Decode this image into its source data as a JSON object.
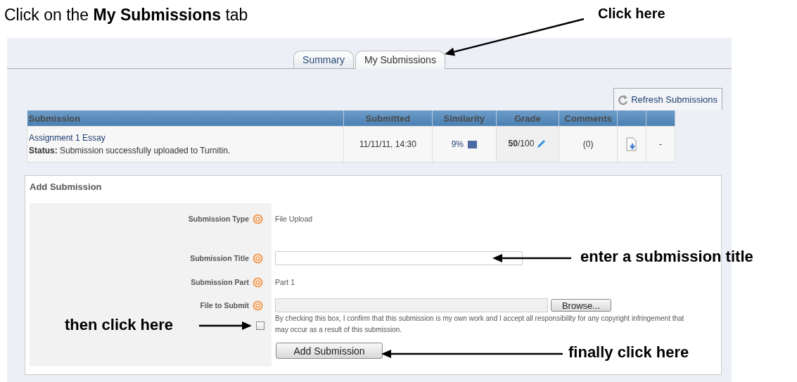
{
  "instruction": "Click on the **My Submissions** tab",
  "callouts": [
    {
      "kind": "tab",
      "text": "Click here"
    },
    {
      "kind": "title",
      "text": "enter a submission title"
    },
    {
      "kind": "checkbox",
      "text": "then click here"
    },
    {
      "kind": "button",
      "text": "finally click here"
    }
  ],
  "tabs": [
    {
      "label": "Summary",
      "selected": false
    },
    {
      "label": "My Submissions",
      "selected": true
    }
  ],
  "refresh_button": "Refresh Submissions",
  "table": {
    "columns": [
      "Submission",
      "Submitted",
      "Similarity",
      "Grade",
      "Comments"
    ],
    "rows": [
      {
        "title": "Assignment 1 Essay",
        "status": "**Status:** Submission successfully uploaded to Turnitin.",
        "submitted": "11/11/11, 14:30",
        "similarity": "9%",
        "grade": "**50**/100",
        "comments": "(0)",
        "column_7": "-"
      }
    ]
  },
  "add_submission": {
    "title": "Add Submission",
    "fields": [
      {
        "kind": "text",
        "label": "Submission Type",
        "value": "File Upload"
      },
      {
        "kind": "input",
        "label": "Submission Title"
      },
      {
        "kind": "text",
        "label": "Submission Part",
        "value": "Part 1"
      },
      {
        "kind": "file",
        "label": "File to Submit",
        "button": "Browse..."
      }
    ],
    "agreement": {
      "checked": false,
      "text": "By checking this box, I confirm that this submission is my own work and I accept all responsibility for any copyright infringement that may occur as a result of this submission."
    },
    "submit_button": "Add Submission"
  }
}
